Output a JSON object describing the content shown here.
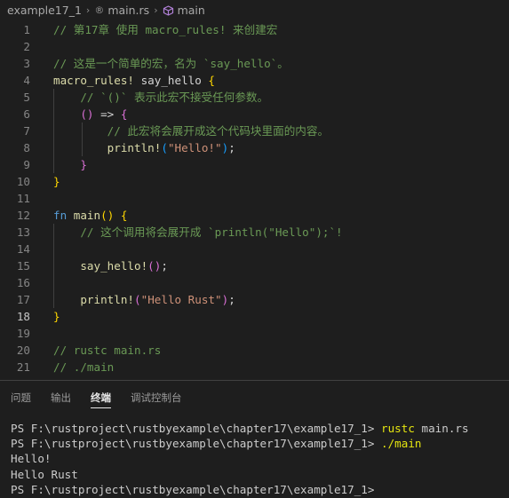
{
  "breadcrumb": {
    "folder": "example17_1",
    "file": "main.rs",
    "symbol": "main"
  },
  "editor": {
    "current_line": 18,
    "lines": [
      {
        "n": "1",
        "tokens": [
          {
            "c": "t-cm",
            "t": "// 第17章 使用 macro_rules! 来创建宏"
          }
        ]
      },
      {
        "n": "2",
        "tokens": []
      },
      {
        "n": "3",
        "tokens": [
          {
            "c": "t-cm",
            "t": "// 这是一个简单的宏，名为 `say_hello`。"
          }
        ]
      },
      {
        "n": "4",
        "tokens": [
          {
            "c": "t-mac",
            "t": "macro_rules!"
          },
          {
            "c": "t-id",
            "t": " say_hello "
          },
          {
            "c": "t-p1",
            "t": "{"
          }
        ]
      },
      {
        "n": "5",
        "tokens": [
          {
            "c": "t-cm",
            "t": "    // `()` 表示此宏不接受任何参数。"
          }
        ]
      },
      {
        "n": "6",
        "tokens": [
          {
            "c": "t-id",
            "t": "    "
          },
          {
            "c": "t-p2",
            "t": "()"
          },
          {
            "c": "t-punc",
            "t": " => "
          },
          {
            "c": "t-p2",
            "t": "{"
          }
        ]
      },
      {
        "n": "7",
        "tokens": [
          {
            "c": "t-cm",
            "t": "        // 此宏将会展开成这个代码块里面的内容。"
          }
        ]
      },
      {
        "n": "8",
        "tokens": [
          {
            "c": "t-id",
            "t": "        "
          },
          {
            "c": "t-mac",
            "t": "println!"
          },
          {
            "c": "t-p3",
            "t": "("
          },
          {
            "c": "t-str",
            "t": "\"Hello!\""
          },
          {
            "c": "t-p3",
            "t": ")"
          },
          {
            "c": "t-punc",
            "t": ";"
          }
        ]
      },
      {
        "n": "9",
        "tokens": [
          {
            "c": "t-id",
            "t": "    "
          },
          {
            "c": "t-p2",
            "t": "}"
          }
        ]
      },
      {
        "n": "10",
        "tokens": [
          {
            "c": "t-p1",
            "t": "}"
          }
        ]
      },
      {
        "n": "11",
        "tokens": []
      },
      {
        "n": "12",
        "tokens": [
          {
            "c": "t-kw",
            "t": "fn"
          },
          {
            "c": "t-id",
            "t": " "
          },
          {
            "c": "t-fn",
            "t": "main"
          },
          {
            "c": "t-p1",
            "t": "()"
          },
          {
            "c": "t-id",
            "t": " "
          },
          {
            "c": "t-p1",
            "t": "{"
          }
        ]
      },
      {
        "n": "13",
        "tokens": [
          {
            "c": "t-cm",
            "t": "    // 这个调用将会展开成 `println(\"Hello\");`!"
          }
        ]
      },
      {
        "n": "14",
        "tokens": []
      },
      {
        "n": "15",
        "tokens": [
          {
            "c": "t-id",
            "t": "    "
          },
          {
            "c": "t-mac",
            "t": "say_hello!"
          },
          {
            "c": "t-p2",
            "t": "()"
          },
          {
            "c": "t-punc",
            "t": ";"
          }
        ]
      },
      {
        "n": "16",
        "tokens": []
      },
      {
        "n": "17",
        "tokens": [
          {
            "c": "t-id",
            "t": "    "
          },
          {
            "c": "t-mac",
            "t": "println!"
          },
          {
            "c": "t-p2",
            "t": "("
          },
          {
            "c": "t-str",
            "t": "\"Hello Rust\""
          },
          {
            "c": "t-p2",
            "t": ")"
          },
          {
            "c": "t-punc",
            "t": ";"
          }
        ]
      },
      {
        "n": "18",
        "tokens": [
          {
            "c": "t-p1",
            "t": "}"
          }
        ]
      },
      {
        "n": "19",
        "tokens": []
      },
      {
        "n": "20",
        "tokens": [
          {
            "c": "t-cm",
            "t": "// rustc main.rs"
          }
        ]
      },
      {
        "n": "21",
        "tokens": [
          {
            "c": "t-cm",
            "t": "// ./main"
          }
        ]
      }
    ]
  },
  "panel": {
    "tabs": [
      "问题",
      "输出",
      "终端",
      "调试控制台"
    ],
    "active_tab": "终端"
  },
  "terminal": {
    "lines": [
      {
        "prompt": "PS F:\\rustproject\\rustbyexample\\chapter17\\example17_1> ",
        "cmd": "rustc",
        "args": " main.rs",
        "out": ""
      },
      {
        "prompt": "PS F:\\rustproject\\rustbyexample\\chapter17\\example17_1> ",
        "cmd": "./main",
        "args": "",
        "out": ""
      },
      {
        "prompt": "",
        "cmd": "",
        "args": "",
        "out": "Hello!"
      },
      {
        "prompt": "",
        "cmd": "",
        "args": "",
        "out": "Hello Rust"
      },
      {
        "prompt": "PS F:\\rustproject\\rustbyexample\\chapter17\\example17_1> ",
        "cmd": "",
        "args": "",
        "out": ""
      }
    ]
  },
  "colors": {
    "background": "#1e1e1e",
    "comment": "#6a9955",
    "macro": "#dcdcaa",
    "keyword": "#569cd6",
    "string": "#ce9178",
    "terminal_command": "#e5e510"
  }
}
